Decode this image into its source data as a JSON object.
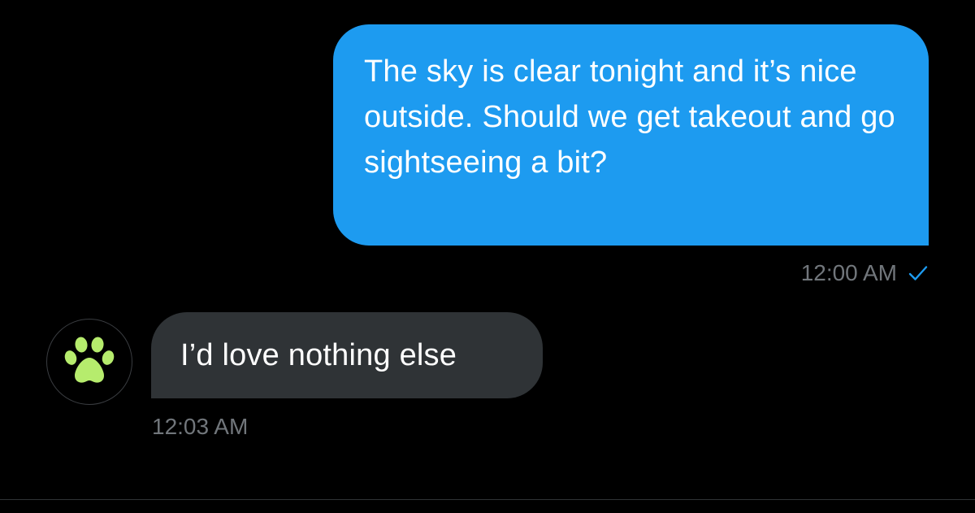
{
  "colors": {
    "background": "#000000",
    "outgoing_bubble": "#1d9bf0",
    "incoming_bubble": "#2f3336",
    "timestamp_text": "#71767b",
    "avatar_icon": "#b6ec6d"
  },
  "messages": [
    {
      "direction": "outgoing",
      "text": "The sky is clear tonight and it’s nice outside. Should we get takeout and go sightseeing a bit?",
      "timestamp": "12:00 AM",
      "status_icon": "check-icon"
    },
    {
      "direction": "incoming",
      "text": "I’d love nothing else",
      "timestamp": "12:03 AM",
      "avatar_icon": "paw-icon"
    }
  ]
}
